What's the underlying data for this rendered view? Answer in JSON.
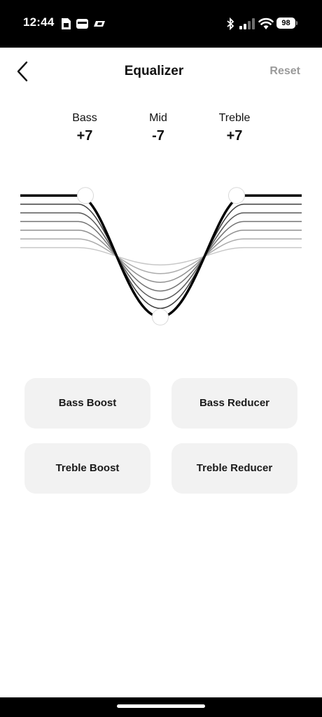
{
  "status_bar": {
    "time": "12:44",
    "battery": "98",
    "icons": [
      "sim-card-icon",
      "wallet-icon",
      "bose-logo-icon",
      "bluetooth-icon",
      "signal-bars-icon",
      "wifi-icon",
      "battery-icon"
    ]
  },
  "header": {
    "back_icon": "chevron-left-icon",
    "title": "Equalizer",
    "reset_label": "Reset"
  },
  "bands": [
    {
      "label": "Bass",
      "value": "+7",
      "level": 7
    },
    {
      "label": "Mid",
      "value": "-7",
      "level": -7
    },
    {
      "label": "Treble",
      "value": "+7",
      "level": 7
    }
  ],
  "presets": [
    {
      "label": "Bass Boost"
    },
    {
      "label": "Bass Reducer"
    },
    {
      "label": "Treble Boost"
    },
    {
      "label": "Treble Reducer"
    }
  ],
  "colors": {
    "background": "#ffffff",
    "button_bg": "#f2f2f2",
    "reset_text": "#9a9a9a",
    "curve_active": "#000000"
  }
}
